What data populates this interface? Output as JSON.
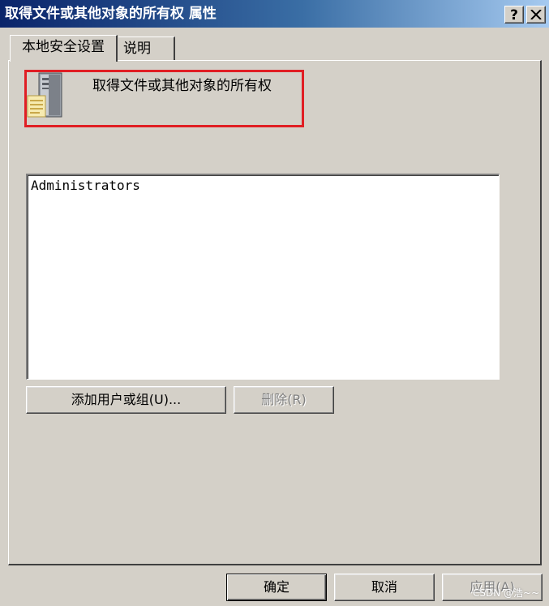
{
  "window": {
    "title": "取得文件或其他对象的所有权 属性",
    "help_button": "?",
    "close_button": "close"
  },
  "tabs": [
    {
      "label": "本地安全设置",
      "active": true
    },
    {
      "label": "说明",
      "active": false
    }
  ],
  "policy": {
    "icon": "server-policy-icon",
    "name": "取得文件或其他对象的所有权"
  },
  "members": [
    "Administrators"
  ],
  "buttons": {
    "add": "添加用户或组(U)...",
    "remove": "删除(R)",
    "ok": "确定",
    "cancel": "取消",
    "apply": "应用(A)"
  },
  "watermark": "CSDN @浩~~",
  "colors": {
    "highlight_border": "#e01e24",
    "titlebar": "#0a246a",
    "face": "#d4d0c8"
  }
}
